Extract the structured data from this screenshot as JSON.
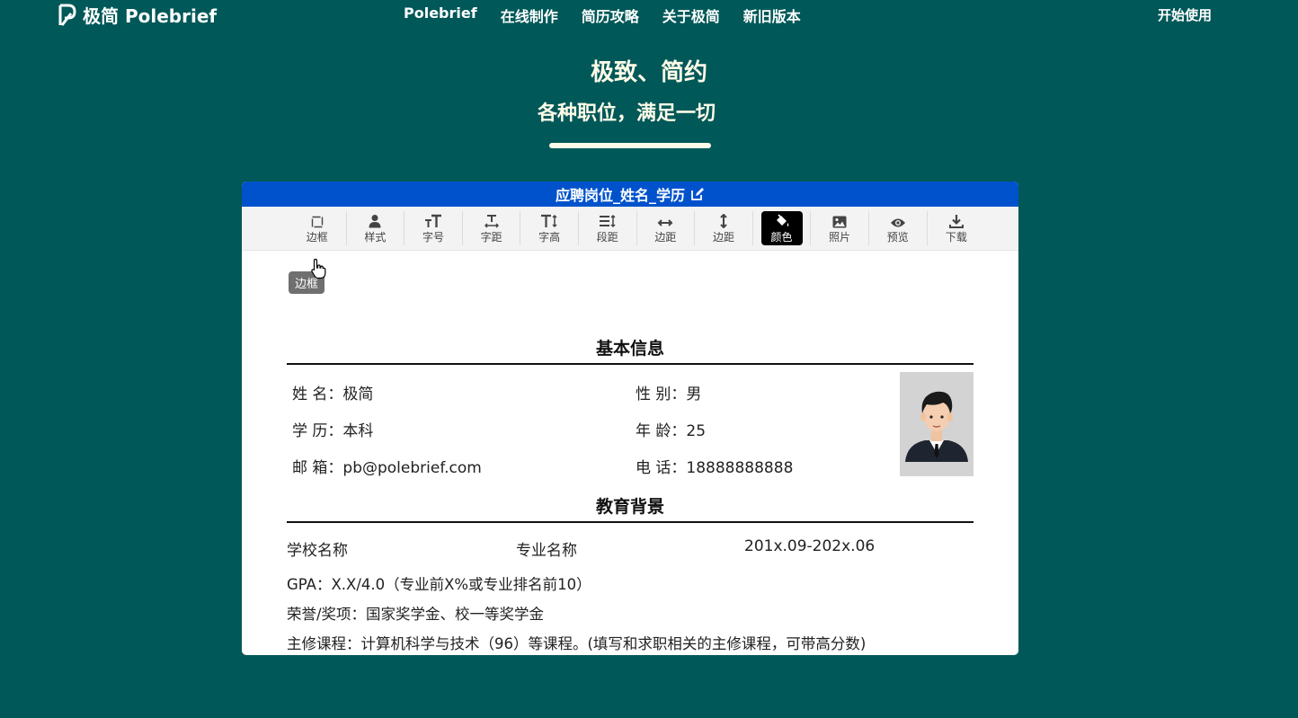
{
  "header": {
    "logo_text": "极简 Polebrief",
    "nav": [
      "Polebrief",
      "在线制作",
      "简历攻略",
      "关于极简",
      "新旧版本"
    ],
    "start_label": "开始使用"
  },
  "hero": {
    "title": "极致、简约",
    "subtitle": "各种职位，满足一切"
  },
  "editor": {
    "title": "应聘岗位_姓名_学历",
    "toolbar": [
      {
        "label": "边框",
        "icon": "border-icon"
      },
      {
        "label": "样式",
        "icon": "person-icon"
      },
      {
        "label": "字号",
        "icon": "font-size-icon"
      },
      {
        "label": "字距",
        "icon": "letter-spacing-icon"
      },
      {
        "label": "字高",
        "icon": "text-height-icon"
      },
      {
        "label": "段距",
        "icon": "paragraph-spacing-icon"
      },
      {
        "label": "边距",
        "icon": "horizontal-arrows-icon"
      },
      {
        "label": "边距",
        "icon": "vertical-arrows-icon"
      },
      {
        "label": "颜色",
        "icon": "paint-bucket-icon"
      },
      {
        "label": "照片",
        "icon": "image-icon"
      },
      {
        "label": "预览",
        "icon": "eye-icon"
      },
      {
        "label": "下载",
        "icon": "download-icon"
      }
    ],
    "tooltip": "边框"
  },
  "resume": {
    "basic_title": "基本信息",
    "basic": {
      "name": "姓 名：极简",
      "gender": "性 别：男",
      "education": "学 历：本科",
      "age": "年 龄：25",
      "email": "邮 箱：pb@polebrief.com",
      "phone": "电 话：18888888888"
    },
    "edu_title": "教育背景",
    "edu": {
      "school": "学校名称",
      "major": "专业名称",
      "period": "201x.09-202x.06",
      "gpa": "GPA：X.X/4.0（专业前X%或专业排名前10）",
      "honors": "荣誉/奖项：国家奖学金、校一等奖学金",
      "courses": "主修课程：计算机科学与技术（96）等课程。(填写和求职相关的主修课程，可带高分数)"
    }
  }
}
